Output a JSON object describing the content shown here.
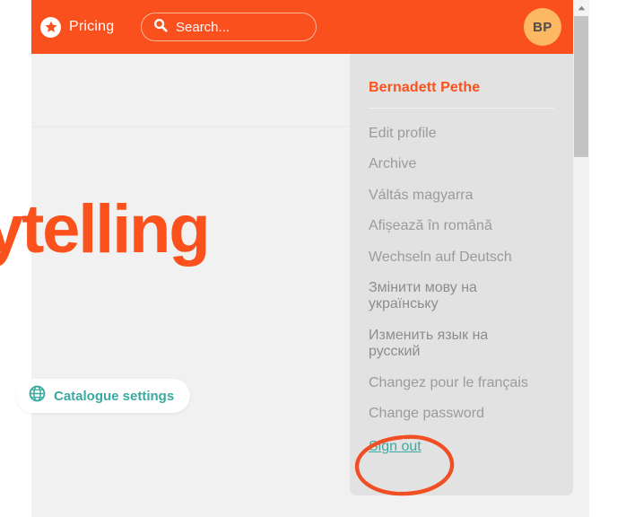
{
  "topbar": {
    "star_icon": "star-icon",
    "pricing_label": "Pricing",
    "search": {
      "icon": "search-icon",
      "placeholder": "Search..."
    },
    "avatar_initials": "BP",
    "background_color": "#f9501e"
  },
  "main": {
    "headline": "ytelling",
    "headline_color": "#fb521d",
    "catalogue_button": {
      "icon": "globe-icon",
      "label": "Catalogue settings",
      "color": "#3aa9a0"
    }
  },
  "user_menu": {
    "user_name": "Bernadett Pethe",
    "user_name_color": "#fb521d",
    "background_color": "#e2e2e2",
    "items": [
      {
        "label": "Edit profile"
      },
      {
        "label": "Archive"
      },
      {
        "label": "Váltás magyarra"
      },
      {
        "label": "Afișează în română"
      },
      {
        "label": "Wechseln auf Deutsch"
      },
      {
        "label": "Змінити мову на\nукраїнську"
      },
      {
        "label": "Изменить язык на\nрусский"
      },
      {
        "label": "Changez pour le français"
      },
      {
        "label": "Change password"
      }
    ],
    "sign_out": {
      "label": "Sign out",
      "color": "#3aa9a0"
    }
  },
  "annotation": {
    "shape": "hand-drawn-ellipse",
    "color": "#f04e23",
    "target": "Sign out"
  },
  "scrollbar": {
    "up_arrow_icon": "chevron-up-icon",
    "thumb_color": "#c3c3c3"
  }
}
